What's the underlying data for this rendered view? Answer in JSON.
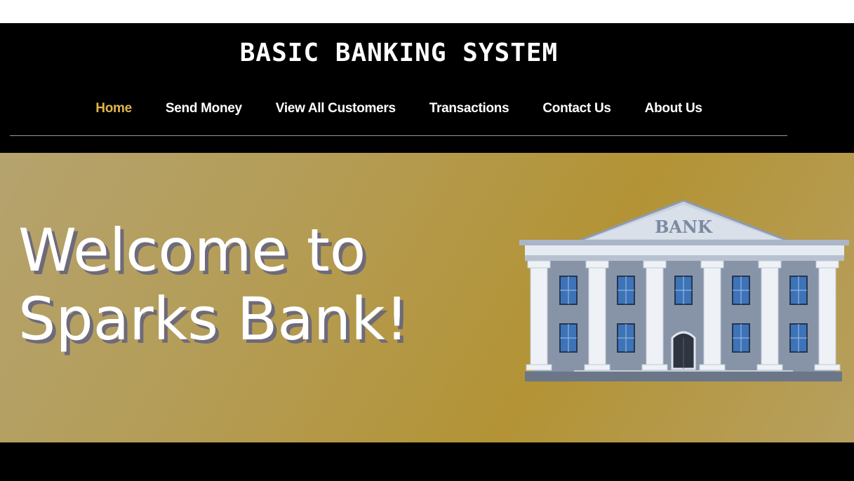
{
  "header": {
    "title": "BASIC BANKING SYSTEM"
  },
  "nav": {
    "items": [
      {
        "label": "Home",
        "active": true
      },
      {
        "label": "Send Money",
        "active": false
      },
      {
        "label": "View All Customers",
        "active": false
      },
      {
        "label": "Transactions",
        "active": false
      },
      {
        "label": "Contact Us",
        "active": false
      },
      {
        "label": "About Us",
        "active": false
      }
    ]
  },
  "hero": {
    "heading_line1": "Welcome to",
    "heading_line2": "Sparks Bank!",
    "illustration": {
      "icon": "bank-building-icon",
      "sign": "BANK"
    }
  },
  "colors": {
    "header_bg": "#000000",
    "active_nav": "#e0b54b",
    "hero_gold": "#b39335",
    "text": "#ffffff"
  }
}
